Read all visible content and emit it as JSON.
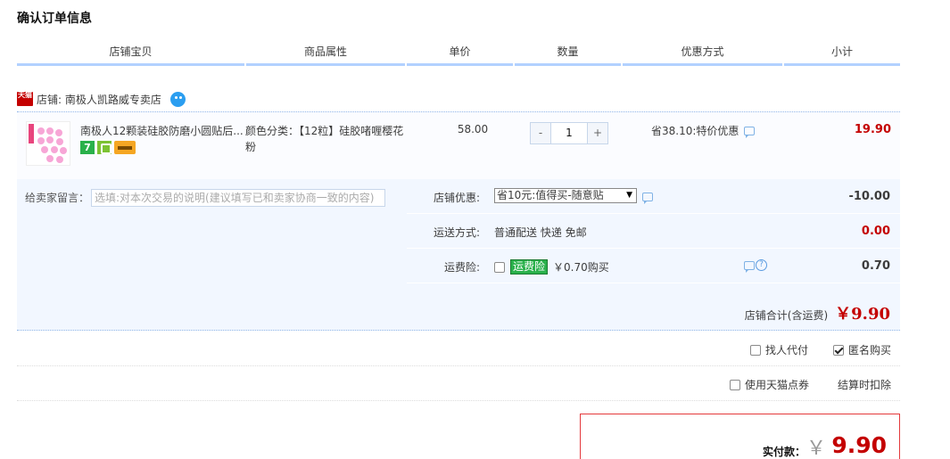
{
  "page_title": "确认订单信息",
  "columns": [
    "店铺宝贝",
    "商品属性",
    "单价",
    "数量",
    "优惠方式",
    "小计"
  ],
  "shop": {
    "tmall_icon_text": "天猫",
    "label": "店铺: 南极人凯路威专卖店"
  },
  "item": {
    "title": "南极人12颗装硅胶防磨小圆贴后...",
    "badge_seven": "7",
    "attr": "颜色分类：【12粒】硅胶啫喱樱花粉",
    "price": "58.00",
    "qty_minus": "-",
    "qty_value": "1",
    "qty_plus": "+",
    "discount": "省38.10:特价优惠",
    "subtotal": "19.90"
  },
  "memo": {
    "label": "给卖家留言：",
    "placeholder": "选填:对本次交易的说明(建议填写已和卖家协商一致的内容)"
  },
  "shop_discount": {
    "label": "店铺优惠:",
    "selected": "省10元:值得买-随意贴",
    "amount": "-10.00"
  },
  "shipping": {
    "label": "运送方式:",
    "value": "普通配送 快递 免邮",
    "amount": "0.00"
  },
  "insurance": {
    "label": "运费险:",
    "tag": "运费险",
    "value": "￥0.70购买",
    "amount": "0.70"
  },
  "shop_total": {
    "label": "店铺合计(含运费)",
    "amount": "￥9.90"
  },
  "options": {
    "proxy_pay": "找人代付",
    "anonymous": "匿名购买",
    "tmall_points": "使用天猫点券",
    "points_note": "结算时扣除"
  },
  "payment": {
    "label": "实付款：",
    "currency": "￥",
    "amount": "9.90"
  },
  "colors": {
    "accent_red": "#c40000",
    "header_line": "#b2d1ff",
    "light_blue_bg": "#f2f7ff"
  }
}
